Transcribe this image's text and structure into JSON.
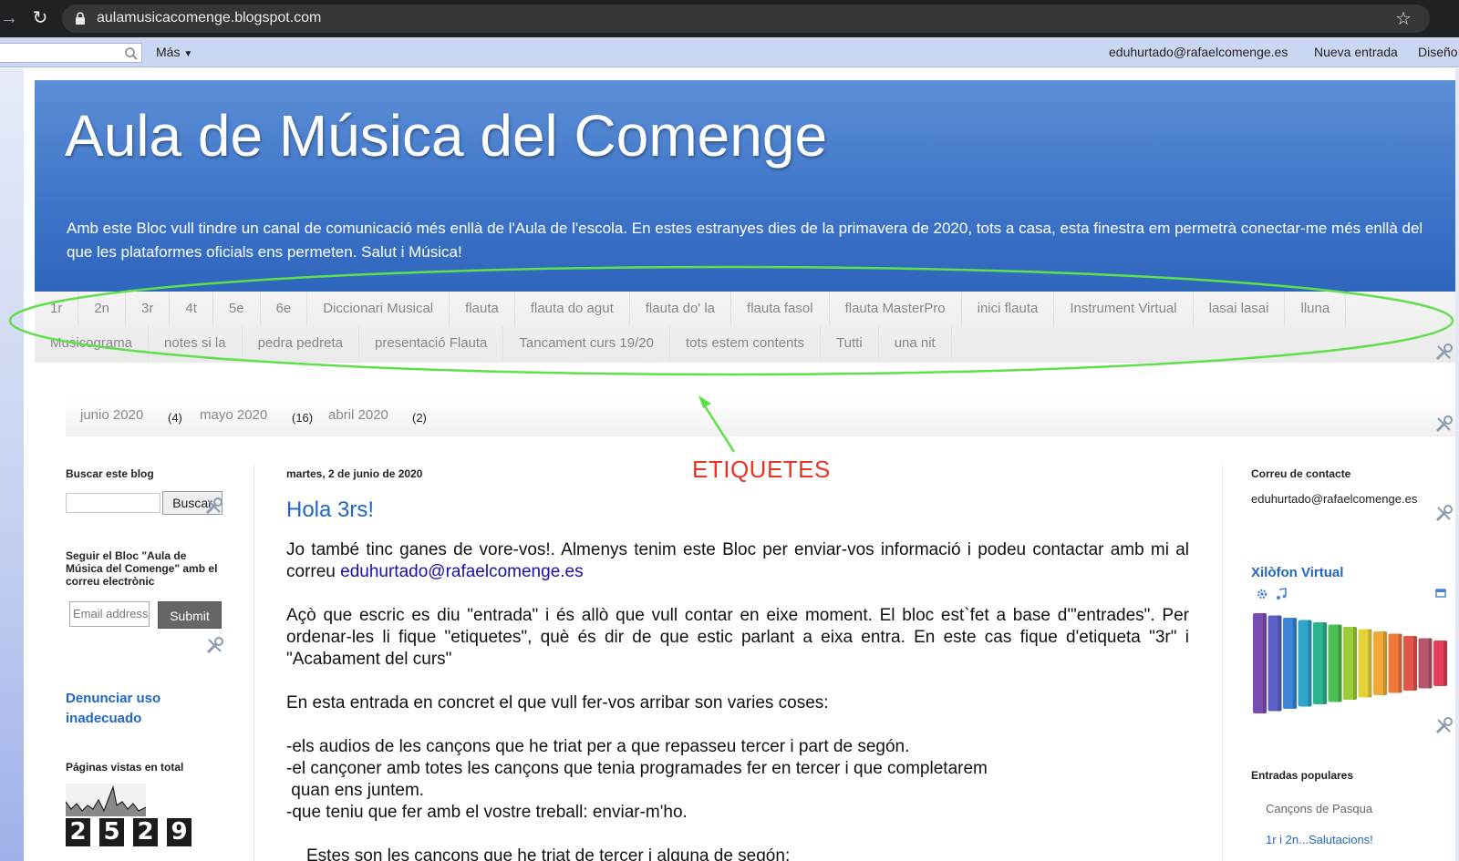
{
  "browser": {
    "url": "aulamusicacomenge.blogspot.com"
  },
  "navbar": {
    "more_label": "Más",
    "user_email": "eduhurtado@rafaelcomenge.es",
    "new_post_label": "Nueva entrada",
    "design_label": "Diseño"
  },
  "header": {
    "title": "Aula de Música del Comenge",
    "description": "Amb este Bloc vull tindre un canal de comunicació més enllà de l'Aula de l'escola. En estes estranyes dies de la primavera de 2020, tots a casa, esta finestra em permetrà conectar-me més enllà del que les plataformes oficials ens permeten. Salut i Música!"
  },
  "labels": {
    "row1": [
      "1r",
      "2n",
      "3r",
      "4t",
      "5e",
      "6e",
      "Diccionari Musical",
      "flauta",
      "flauta do agut",
      "flauta do' la",
      "flauta fasol",
      "flauta MasterPro",
      "inici flauta",
      "Instrument Virtual",
      "lasai lasai",
      "lluna"
    ],
    "row2": [
      "Musicograma",
      "notes si la",
      "pedra pedreta",
      "presentació Flauta",
      "Tancament curs 19/20",
      "tots estem contents",
      "Tutti",
      "una nit"
    ]
  },
  "archive": {
    "items": [
      {
        "month": "junio 2020",
        "count": "(4)"
      },
      {
        "month": "mayo 2020",
        "count": "(16)"
      },
      {
        "month": "abril 2020",
        "count": "(2)"
      }
    ]
  },
  "left_sidebar": {
    "search_title": "Buscar este blog",
    "search_button": "Buscar",
    "follow_text": "Seguir el Bloc \"Aula de Música del Comenge\" amb el correu electrònic",
    "email_placeholder": "Email address...",
    "submit_label": "Submit",
    "report_label": "Denunciar uso inadecuado",
    "pageviews_title": "Páginas vistas en total",
    "pageviews_digits": [
      "2",
      "5",
      "2",
      "9"
    ]
  },
  "post": {
    "date": "martes, 2 de junio de 2020",
    "title": "Hola 3rs!",
    "p1_text": "Jo també tinc ganes de vore-vos!. Almenys tenim este Bloc per enviar-vos informació i podeu contactar amb mi al correu ",
    "p1_link": "eduhurtado@rafaelcomenge.es",
    "p2": "Açò que escric es diu \"entrada\" i és allò que vull contar en eixe moment. El bloc est`fet a base d'\"entrades\". Per ordenar-les li fique \"etiquetes\", què és dir de que estic parlant a eixa entra. En este cas fique d'etiqueta \"3r\" i \"Acabament del curs\"",
    "p3": "En esta entrada en concret el que vull fer-vos arribar son varies coses:",
    "list": [
      "-els audios de les cançons que he triat per a que repasseu tercer i part de segón.",
      "-el cançoner amb totes les cançons que tenia programades fer en tercer i que completarem",
      " quan ens juntem.",
      "-que teniu que fer amb el vostre treball: enviar-m'ho."
    ],
    "p4": "Estes son les cançons que he triat de tercer i alguna de segón:"
  },
  "right_sidebar": {
    "contact_title": "Correu de contacte",
    "contact_email": "eduhurtado@rafaelcomenge.es",
    "xylophone_title": "Xilòfon Virtual",
    "popular_title": "Entradas populares",
    "popular": [
      "Cançons de Pasqua",
      "1r i 2n...Salutacions!"
    ]
  },
  "annotation": {
    "label": "ETIQUETES",
    "color": "#e53524",
    "ellipse_color": "#5fe04a"
  },
  "colors": {
    "link_blue": "#2166c0",
    "header_blue": "#3d74c8"
  }
}
